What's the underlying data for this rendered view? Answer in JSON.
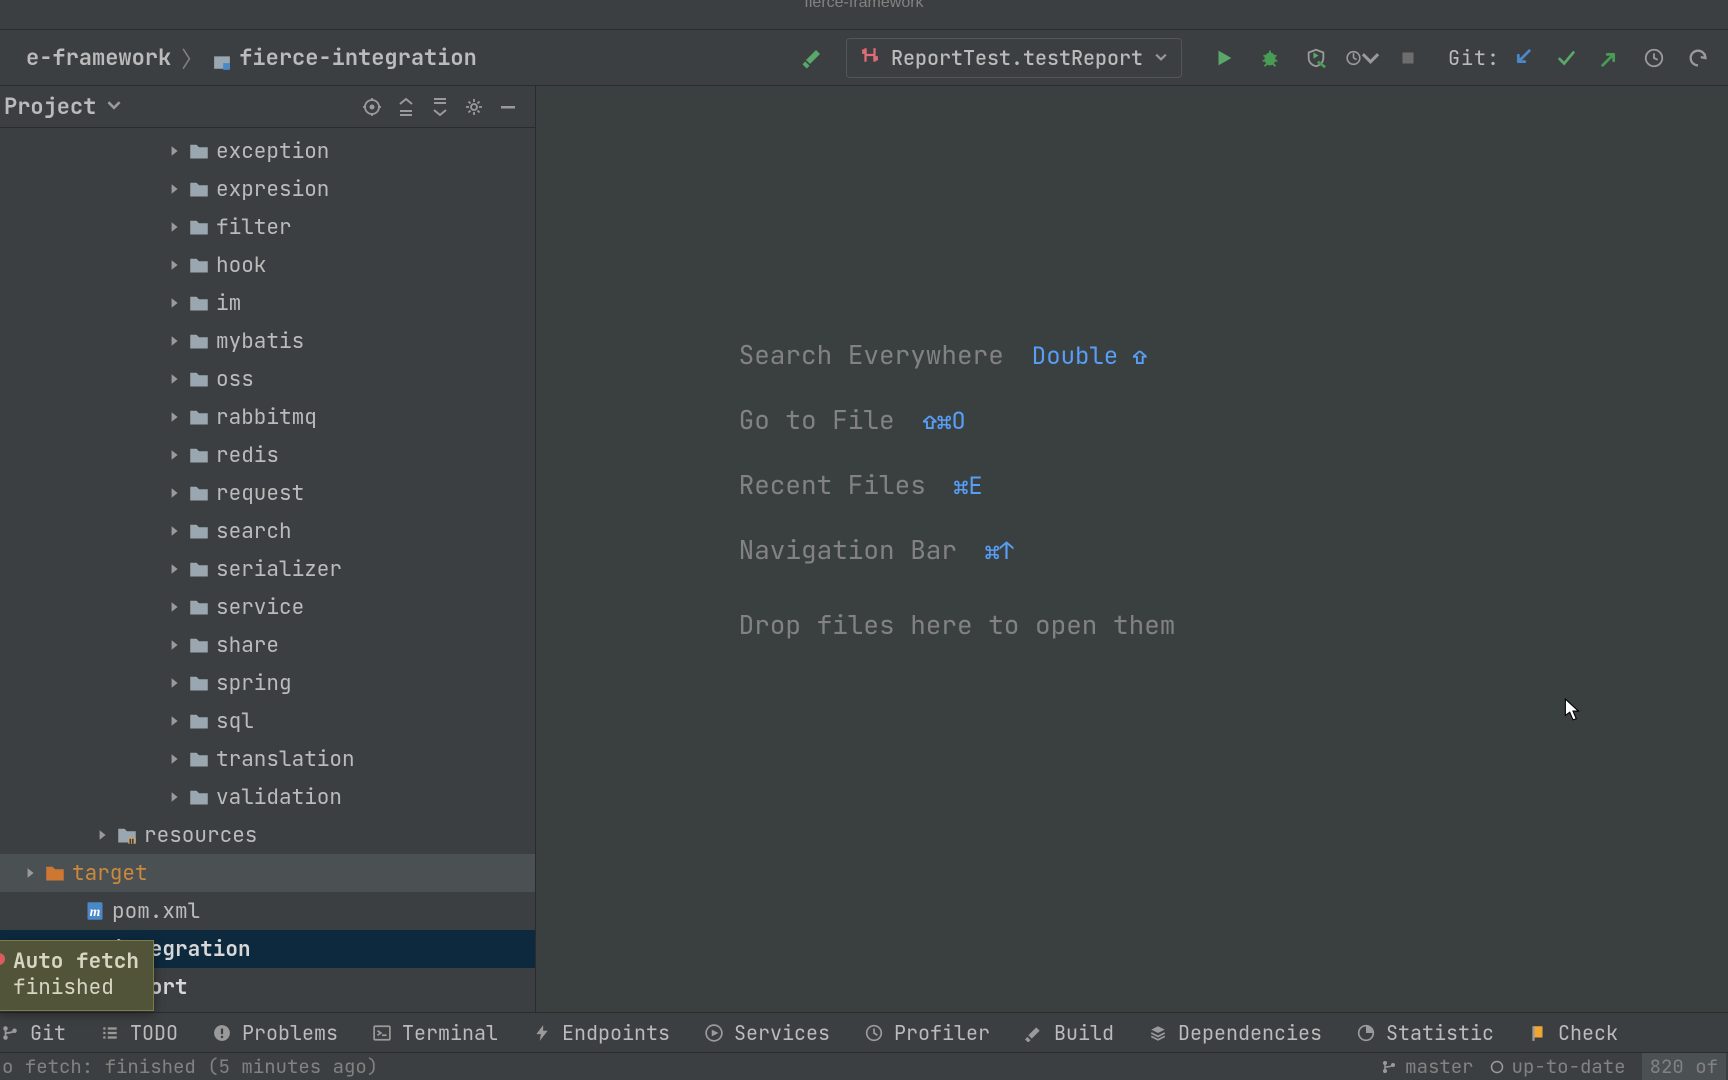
{
  "window": {
    "title": "fierce-framework"
  },
  "breadcrumbs": [
    {
      "label": "e-framework",
      "icon": "module"
    },
    {
      "label": "fierce-integration",
      "icon": "module"
    }
  ],
  "run_config": {
    "label": "ReportTest.testReport"
  },
  "git": {
    "label": "Git:"
  },
  "project": {
    "title": "Project",
    "tree": [
      {
        "depth": 3,
        "kind": "folder",
        "label": "exception"
      },
      {
        "depth": 3,
        "kind": "folder",
        "label": "expresion"
      },
      {
        "depth": 3,
        "kind": "folder",
        "label": "filter"
      },
      {
        "depth": 3,
        "kind": "folder",
        "label": "hook"
      },
      {
        "depth": 3,
        "kind": "folder",
        "label": "im"
      },
      {
        "depth": 3,
        "kind": "folder",
        "label": "mybatis"
      },
      {
        "depth": 3,
        "kind": "folder",
        "label": "oss"
      },
      {
        "depth": 3,
        "kind": "folder",
        "label": "rabbitmq"
      },
      {
        "depth": 3,
        "kind": "folder",
        "label": "redis"
      },
      {
        "depth": 3,
        "kind": "folder",
        "label": "request"
      },
      {
        "depth": 3,
        "kind": "folder",
        "label": "search"
      },
      {
        "depth": 3,
        "kind": "folder",
        "label": "serializer"
      },
      {
        "depth": 3,
        "kind": "folder",
        "label": "service"
      },
      {
        "depth": 3,
        "kind": "folder",
        "label": "share"
      },
      {
        "depth": 3,
        "kind": "folder",
        "label": "spring"
      },
      {
        "depth": 3,
        "kind": "folder",
        "label": "sql"
      },
      {
        "depth": 3,
        "kind": "folder",
        "label": "translation"
      },
      {
        "depth": 3,
        "kind": "folder",
        "label": "validation"
      },
      {
        "depth": 2,
        "kind": "resources",
        "label": "resources"
      },
      {
        "depth": 1,
        "kind": "target",
        "label": "target",
        "orange": true,
        "hl": true
      },
      {
        "depth": 0,
        "kind": "pom",
        "label": "pom.xml"
      },
      {
        "depth": 0,
        "kind": "module",
        "label": "integration",
        "selected": true,
        "bold": true
      },
      {
        "depth": 0,
        "kind": "module",
        "label": "report",
        "bold": true
      }
    ]
  },
  "editor_hints": [
    {
      "txt": "Search Everywhere",
      "key": "Double ⇧"
    },
    {
      "txt": "Go to File",
      "key": "⇧⌘O"
    },
    {
      "txt": "Recent Files",
      "key": "⌘E"
    },
    {
      "txt": "Navigation Bar",
      "key": "⌘↑"
    }
  ],
  "editor_drop": "Drop files here to open them",
  "bottom_tabs": [
    {
      "icon": "branch",
      "label": "Git"
    },
    {
      "icon": "list",
      "label": "TODO"
    },
    {
      "icon": "warn",
      "label": "Problems"
    },
    {
      "icon": "terminal",
      "label": "Terminal"
    },
    {
      "icon": "bolt",
      "label": "Endpoints"
    },
    {
      "icon": "play",
      "label": "Services"
    },
    {
      "icon": "clock",
      "label": "Profiler"
    },
    {
      "icon": "hammer",
      "label": "Build"
    },
    {
      "icon": "layers",
      "label": "Dependencies"
    },
    {
      "icon": "pie",
      "label": "Statistic"
    },
    {
      "icon": "flag",
      "label": "Check"
    }
  ],
  "status": {
    "msg": "o fetch: finished (5 minutes ago)",
    "branch": "master",
    "uptodate": "up-to-date",
    "right": "820 of"
  },
  "notification": {
    "title": "Auto fetch",
    "body": "finished"
  }
}
